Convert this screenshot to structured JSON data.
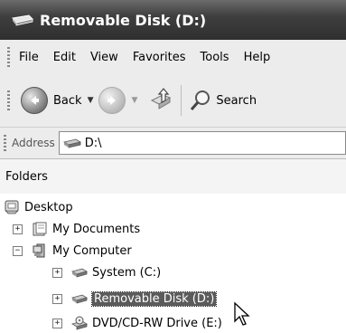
{
  "window": {
    "title": "Removable Disk (D:)"
  },
  "menu": [
    "File",
    "Edit",
    "View",
    "Favorites",
    "Tools",
    "Help"
  ],
  "toolbar": {
    "back_label": "Back",
    "search_label": "Search"
  },
  "address": {
    "label": "Address",
    "value": "D:\\"
  },
  "folders_pane": {
    "title": "Folders"
  },
  "tree": [
    {
      "label": "Desktop",
      "icon": "desktop-icon",
      "expander": ""
    },
    {
      "label": "My Documents",
      "icon": "documents-folder-icon",
      "expander": "+"
    },
    {
      "label": "My Computer",
      "icon": "computer-icon",
      "expander": "−"
    },
    {
      "label": "System (C:)",
      "icon": "drive-icon",
      "expander": "+"
    },
    {
      "label": "Removable Disk (D:)",
      "icon": "drive-icon",
      "expander": "+",
      "selected": true
    },
    {
      "label": "DVD/CD-RW Drive (E:)",
      "icon": "dvd-drive-icon",
      "expander": "+"
    }
  ]
}
